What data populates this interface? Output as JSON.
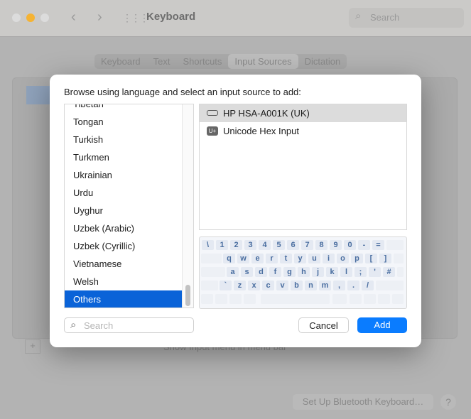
{
  "window": {
    "title": "Keyboard",
    "search_placeholder": "Search"
  },
  "tabs": [
    {
      "label": "Keyboard"
    },
    {
      "label": "Text"
    },
    {
      "label": "Shortcuts"
    },
    {
      "label": "Input Sources",
      "selected": true
    },
    {
      "label": "Dictation"
    }
  ],
  "background": {
    "show_input_menu": "Show Input menu in menu bar",
    "bluetooth_button": "Set Up Bluetooth Keyboard…",
    "help": "?",
    "add": "+",
    "remove": "−"
  },
  "dialog": {
    "prompt": "Browse using language and select an input source to add:",
    "languages": [
      "Tibetan",
      "Tongan",
      "Turkish",
      "Turkmen",
      "Ukrainian",
      "Urdu",
      "Uyghur",
      "Uzbek (Arabic)",
      "Uzbek (Cyrillic)",
      "Vietnamese",
      "Welsh",
      "Others"
    ],
    "selected_language": "Others",
    "sources": [
      {
        "label": "HP HSA-A001K (UK)",
        "icon": "keyboard-icon",
        "selected": true
      },
      {
        "label": "Unicode Hex Input",
        "icon": "unicode-icon",
        "badge": "U+"
      }
    ],
    "keyboard_rows": [
      [
        "\\",
        "1",
        "2",
        "3",
        "4",
        "5",
        "6",
        "7",
        "8",
        "9",
        "0",
        "-",
        "="
      ],
      [
        "q",
        "w",
        "e",
        "r",
        "t",
        "y",
        "u",
        "i",
        "o",
        "p",
        "[",
        "]"
      ],
      [
        "a",
        "s",
        "d",
        "f",
        "g",
        "h",
        "j",
        "k",
        "l",
        ";",
        "'",
        "#"
      ],
      [
        "`",
        "z",
        "x",
        "c",
        "v",
        "b",
        "n",
        "m",
        ",",
        ".",
        "/"
      ]
    ],
    "search_placeholder": "Search",
    "cancel": "Cancel",
    "add": "Add"
  },
  "colors": {
    "accent": "#0a7cff",
    "selection": "#0a63d8",
    "key_text": "#4a6ea0",
    "close": "#dcdcdc",
    "minimize": "#f5b333"
  }
}
